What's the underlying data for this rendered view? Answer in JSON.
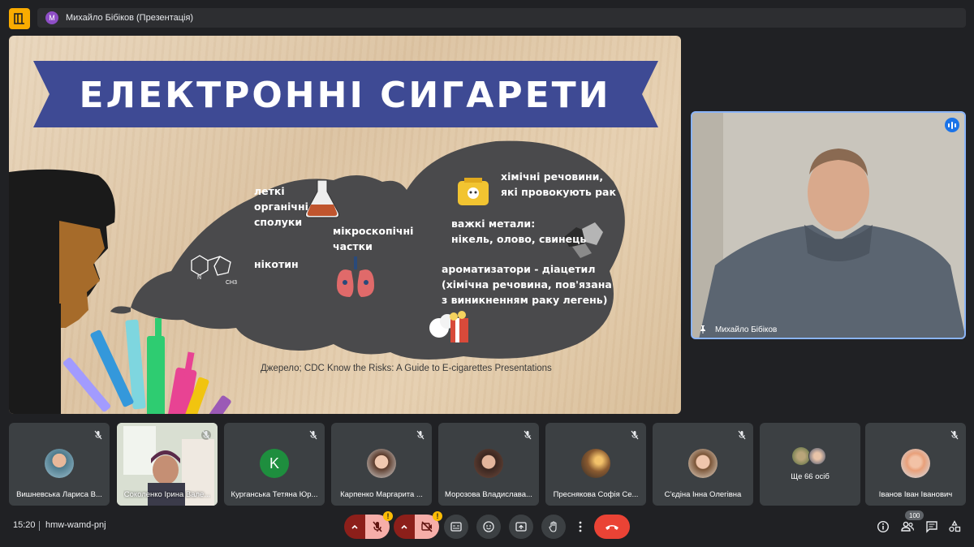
{
  "header": {
    "presenter_avatar_letter": "М",
    "presenter_label": "Михайло Бібіков (Презентація)"
  },
  "slide": {
    "title": "Електронні сигарети",
    "items": {
      "volatile": [
        "леткі",
        "органічні",
        "сполуки"
      ],
      "micro": [
        "мікроскопічні",
        "частки"
      ],
      "nicotine": "нікотин",
      "carcinogens": [
        "хімічні речовини,",
        "які провокують рак"
      ],
      "metals": [
        "важкі метали:",
        "нікель, олово, свинець"
      ],
      "flavors": [
        "ароматизатори - діацетил",
        "(хімічна речовина,  пов'язана",
        "з виникненням раку легень)"
      ]
    },
    "source": "Джерело; CDC Know the Risks: A Guide to E-cigarettes Presentations",
    "colors": {
      "banner": "#3e4a94",
      "cloud": "#4a4a4c",
      "face": "#a66b2a",
      "hair": "#1a1a1a"
    }
  },
  "presenter_tile": {
    "name": "Михайло Бібіков"
  },
  "participants": [
    {
      "name": "Вишневська Лариса В...",
      "type": "photo"
    },
    {
      "name": "Соколенко Ірина Вале...",
      "type": "video"
    },
    {
      "name": "Курганська Тетяна Юр...",
      "type": "letter",
      "letter": "K",
      "color": "#1e8e3e"
    },
    {
      "name": "Карпенко Маргарита ...",
      "type": "photo"
    },
    {
      "name": "Морозова Владислава...",
      "type": "photo"
    },
    {
      "name": "Преснякова Софія Се...",
      "type": "photo"
    },
    {
      "name": "С'єдіна Інна Олегівна",
      "type": "photo"
    },
    {
      "name": "Ще 66 осіб",
      "type": "more"
    },
    {
      "name": "Іванов Іван Іванович",
      "type": "photo"
    }
  ],
  "bottom_bar": {
    "time": "15:20",
    "meeting_code": "hmw-wamd-pnj",
    "people_count": "100",
    "warning_mark": "!"
  },
  "icons": {
    "mic": "mic-off-icon",
    "camera": "camera-off-icon",
    "captions": "captions-icon",
    "emoji": "emoji-icon",
    "present": "present-screen-icon",
    "hand": "raise-hand-icon",
    "more": "more-vert-icon",
    "leave": "hang-up-icon",
    "info": "info-icon",
    "people": "people-icon",
    "chat": "chat-icon",
    "activities": "activities-icon"
  }
}
